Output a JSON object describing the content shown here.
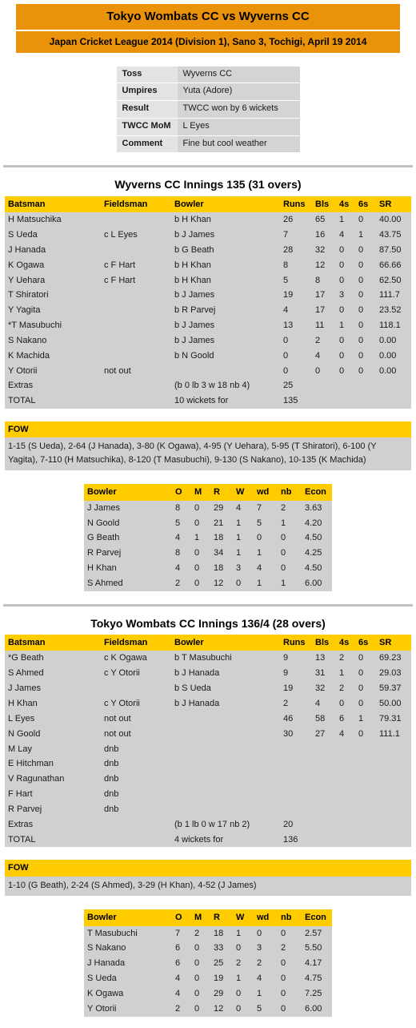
{
  "header": {
    "title": "Tokyo Wombats CC vs Wyverns CC",
    "subtitle": "Japan Cricket League 2014 (Division 1), Sano 3, Tochigi, April 19 2014"
  },
  "colors": {
    "banner_orange": "#ea9209",
    "table_header_yellow": "#ffcc00",
    "row_grey": "#d0d0d0",
    "label_grey": "#e3e3e3",
    "divider_grey": "#c2c2c2"
  },
  "match_info": {
    "rows": [
      {
        "label": "Toss",
        "value": "Wyverns CC"
      },
      {
        "label": "Umpires",
        "value": "Yuta (Adore)"
      },
      {
        "label": "Result",
        "value": "TWCC won by 6 wickets"
      },
      {
        "label": "TWCC MoM",
        "value": "L Eyes"
      },
      {
        "label": "Comment",
        "value": "Fine but cool weather"
      }
    ]
  },
  "batting_columns": [
    "Batsman",
    "Fieldsman",
    "Bowler",
    "Runs",
    "Bls",
    "4s",
    "6s",
    "SR"
  ],
  "bowling_columns": [
    "Bowler",
    "O",
    "M",
    "R",
    "W",
    "wd",
    "nb",
    "Econ"
  ],
  "fow_label": "FOW",
  "innings": [
    {
      "title": "Wyverns CC Innings 135 (31 overs)",
      "batting": [
        {
          "batsman": "H Matsuchika",
          "fieldsman": "",
          "bowler": "b H Khan",
          "runs": "26",
          "bls": "65",
          "fours": "1",
          "sixes": "0",
          "sr": "40.00"
        },
        {
          "batsman": "S Ueda",
          "fieldsman": "c L Eyes",
          "bowler": "b J James",
          "runs": "7",
          "bls": "16",
          "fours": "4",
          "sixes": "1",
          "sr": "43.75"
        },
        {
          "batsman": "J Hanada",
          "fieldsman": "",
          "bowler": "b G Beath",
          "runs": "28",
          "bls": "32",
          "fours": "0",
          "sixes": "0",
          "sr": "87.50"
        },
        {
          "batsman": "K Ogawa",
          "fieldsman": "c F Hart",
          "bowler": "b H Khan",
          "runs": "8",
          "bls": "12",
          "fours": "0",
          "sixes": "0",
          "sr": "66.66"
        },
        {
          "batsman": "Y Uehara",
          "fieldsman": "c F Hart",
          "bowler": "b H Khan",
          "runs": "5",
          "bls": "8",
          "fours": "0",
          "sixes": "0",
          "sr": "62.50"
        },
        {
          "batsman": "T Shiratori",
          "fieldsman": "",
          "bowler": "b J James",
          "runs": "19",
          "bls": "17",
          "fours": "3",
          "sixes": "0",
          "sr": "111.7"
        },
        {
          "batsman": "Y Yagita",
          "fieldsman": "",
          "bowler": "b R Parvej",
          "runs": "4",
          "bls": "17",
          "fours": "0",
          "sixes": "0",
          "sr": "23.52"
        },
        {
          "batsman": "*T Masubuchi",
          "fieldsman": "",
          "bowler": "b J James",
          "runs": "13",
          "bls": "11",
          "fours": "1",
          "sixes": "0",
          "sr": "118.1"
        },
        {
          "batsman": "S Nakano",
          "fieldsman": "",
          "bowler": "b J James",
          "runs": "0",
          "bls": "2",
          "fours": "0",
          "sixes": "0",
          "sr": "0.00"
        },
        {
          "batsman": "K Machida",
          "fieldsman": "",
          "bowler": "b N Goold",
          "runs": "0",
          "bls": "4",
          "fours": "0",
          "sixes": "0",
          "sr": "0.00"
        },
        {
          "batsman": "Y Otorii",
          "fieldsman": "not out",
          "bowler": "",
          "runs": "0",
          "bls": "0",
          "fours": "0",
          "sixes": "0",
          "sr": "0.00"
        },
        {
          "batsman": "Extras",
          "fieldsman": "",
          "bowler": "(b 0 lb 3 w 18 nb 4)",
          "runs": "25",
          "bls": "",
          "fours": "",
          "sixes": "",
          "sr": ""
        },
        {
          "batsman": "TOTAL",
          "fieldsman": "",
          "bowler": "10 wickets for",
          "runs": "135",
          "bls": "",
          "fours": "",
          "sixes": "",
          "sr": ""
        }
      ],
      "fow": "1-15 (S Ueda), 2-64 (J Hanada), 3-80 (K Ogawa), 4-95 (Y Uehara), 5-95 (T Shiratori), 6-100 (Y Yagita), 7-110 (H Matsuchika), 8-120 (T Masubuchi), 9-130 (S Nakano), 10-135 (K Machida)",
      "bowling": [
        {
          "bowler": "J James",
          "o": "8",
          "m": "0",
          "r": "29",
          "w": "4",
          "wd": "7",
          "nb": "2",
          "econ": "3.63"
        },
        {
          "bowler": "N Goold",
          "o": "5",
          "m": "0",
          "r": "21",
          "w": "1",
          "wd": "5",
          "nb": "1",
          "econ": "4.20"
        },
        {
          "bowler": "G Beath",
          "o": "4",
          "m": "1",
          "r": "18",
          "w": "1",
          "wd": "0",
          "nb": "0",
          "econ": "4.50"
        },
        {
          "bowler": "R Parvej",
          "o": "8",
          "m": "0",
          "r": "34",
          "w": "1",
          "wd": "1",
          "nb": "0",
          "econ": "4.25"
        },
        {
          "bowler": "H Khan",
          "o": "4",
          "m": "0",
          "r": "18",
          "w": "3",
          "wd": "4",
          "nb": "0",
          "econ": "4.50"
        },
        {
          "bowler": "S Ahmed",
          "o": "2",
          "m": "0",
          "r": "12",
          "w": "0",
          "wd": "1",
          "nb": "1",
          "econ": "6.00"
        }
      ]
    },
    {
      "title": "Tokyo Wombats CC Innings 136/4 (28 overs)",
      "batting": [
        {
          "batsman": "*G Beath",
          "fieldsman": "c K Ogawa",
          "bowler": "b T Masubuchi",
          "runs": "9",
          "bls": "13",
          "fours": "2",
          "sixes": "0",
          "sr": "69.23"
        },
        {
          "batsman": "S Ahmed",
          "fieldsman": "c Y Otorii",
          "bowler": "b J Hanada",
          "runs": "9",
          "bls": "31",
          "fours": "1",
          "sixes": "0",
          "sr": "29.03"
        },
        {
          "batsman": "J James",
          "fieldsman": "",
          "bowler": "b S Ueda",
          "runs": "19",
          "bls": "32",
          "fours": "2",
          "sixes": "0",
          "sr": "59.37"
        },
        {
          "batsman": "H Khan",
          "fieldsman": "c Y Otorii",
          "bowler": "b J Hanada",
          "runs": "2",
          "bls": "4",
          "fours": "0",
          "sixes": "0",
          "sr": "50.00"
        },
        {
          "batsman": "L Eyes",
          "fieldsman": "not out",
          "bowler": "",
          "runs": "46",
          "bls": "58",
          "fours": "6",
          "sixes": "1",
          "sr": "79.31"
        },
        {
          "batsman": "N Goold",
          "fieldsman": "not out",
          "bowler": "",
          "runs": "30",
          "bls": "27",
          "fours": "4",
          "sixes": "0",
          "sr": "111.1"
        },
        {
          "batsman": "M Lay",
          "fieldsman": "dnb",
          "bowler": "",
          "runs": "",
          "bls": "",
          "fours": "",
          "sixes": "",
          "sr": ""
        },
        {
          "batsman": "E Hitchman",
          "fieldsman": "dnb",
          "bowler": "",
          "runs": "",
          "bls": "",
          "fours": "",
          "sixes": "",
          "sr": ""
        },
        {
          "batsman": "V Ragunathan",
          "fieldsman": "dnb",
          "bowler": "",
          "runs": "",
          "bls": "",
          "fours": "",
          "sixes": "",
          "sr": ""
        },
        {
          "batsman": "F Hart",
          "fieldsman": "dnb",
          "bowler": "",
          "runs": "",
          "bls": "",
          "fours": "",
          "sixes": "",
          "sr": ""
        },
        {
          "batsman": "R Parvej",
          "fieldsman": "dnb",
          "bowler": "",
          "runs": "",
          "bls": "",
          "fours": "",
          "sixes": "",
          "sr": ""
        },
        {
          "batsman": "Extras",
          "fieldsman": "",
          "bowler": "(b 1 lb 0 w 17 nb 2)",
          "runs": "20",
          "bls": "",
          "fours": "",
          "sixes": "",
          "sr": ""
        },
        {
          "batsman": "TOTAL",
          "fieldsman": "",
          "bowler": "4 wickets for",
          "runs": "136",
          "bls": "",
          "fours": "",
          "sixes": "",
          "sr": ""
        }
      ],
      "fow": "1-10 (G Beath), 2-24 (S Ahmed), 3-29 (H Khan), 4-52 (J James)",
      "bowling": [
        {
          "bowler": "T Masubuchi",
          "o": "7",
          "m": "2",
          "r": "18",
          "w": "1",
          "wd": "0",
          "nb": "0",
          "econ": "2.57"
        },
        {
          "bowler": "S Nakano",
          "o": "6",
          "m": "0",
          "r": "33",
          "w": "0",
          "wd": "3",
          "nb": "2",
          "econ": "5.50"
        },
        {
          "bowler": "J Hanada",
          "o": "6",
          "m": "0",
          "r": "25",
          "w": "2",
          "wd": "2",
          "nb": "0",
          "econ": "4.17"
        },
        {
          "bowler": "S Ueda",
          "o": "4",
          "m": "0",
          "r": "19",
          "w": "1",
          "wd": "4",
          "nb": "0",
          "econ": "4.75"
        },
        {
          "bowler": "K Ogawa",
          "o": "4",
          "m": "0",
          "r": "29",
          "w": "0",
          "wd": "1",
          "nb": "0",
          "econ": "7.25"
        },
        {
          "bowler": "Y Otorii",
          "o": "2",
          "m": "0",
          "r": "12",
          "w": "0",
          "wd": "5",
          "nb": "0",
          "econ": "6.00"
        }
      ]
    }
  ]
}
